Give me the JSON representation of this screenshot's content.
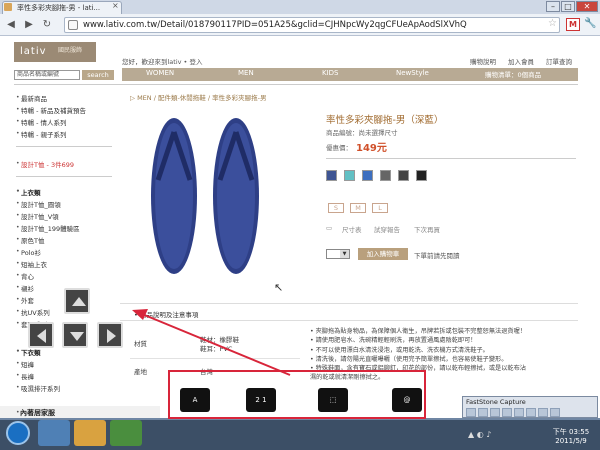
{
  "browser": {
    "tab_title": "率性多彩夾腳拖-男 - lati...",
    "tab_close": "×",
    "url": "www.lativ.com.tw/Detail/018790117PID=051A25&gclid=CJHNpcWy2qgCFUeApAodSlXVhQ",
    "win_min": "–",
    "win_max": "□",
    "win_close": "✕"
  },
  "site": {
    "logo": "lativ",
    "logo_sub": "國民服飾",
    "greeting": "您好，歡迎來到lativ • 登入",
    "top_links": [
      "購物說明",
      "加入會員",
      "訂單查詢"
    ],
    "search_placeholder": "商品名稱或編號",
    "search_button": "search",
    "categories": [
      "WOMEN",
      "MEN",
      "KIDS",
      "NewStyle"
    ],
    "cart": "購物清單：0個商品"
  },
  "sidebar": {
    "group1": [
      "最新商品",
      "特輯 - 新品及補貨預告",
      "特輯 - 情人系列",
      "特輯 - 親子系列"
    ],
    "promo": "設計T恤 - 3件699",
    "section_title": "上衣類",
    "group2": [
      "設計T恤_圓領",
      "設計T恤_V領",
      "設計T恤_199體驗區",
      "原色T恤",
      "Polo衫",
      "短袖上衣",
      "背心",
      "襯衫",
      "外套",
      "抗UV系列",
      "套頭系列"
    ],
    "section_title2": "下衣類",
    "group3": [
      "短褲",
      "長褲",
      "吸濕排汗系列"
    ],
    "bottom": "內著居家服"
  },
  "product": {
    "breadcrumb": "▷ MEN / 配件類-休閒拖鞋 / 率性多彩夾腳拖-男",
    "title": "率性多彩夾腳拖-男（深藍）",
    "code": "商品編號：尚未選擇尺寸",
    "price_label": "優惠價：",
    "price": "149元",
    "sizes": [
      "S",
      "M",
      "L"
    ],
    "actions": [
      "尺寸表",
      "試穿報告",
      "下次再買"
    ],
    "add_to_cart": "加入購物車",
    "add_note": "下單前請先閱讀",
    "notice_title": "• 商品說明及注意事項",
    "spec_rows": [
      {
        "label": "材質",
        "value": "鞋材：橡膠鞋\n鞋耳：PVC"
      },
      {
        "label": "產地",
        "value": "台灣"
      }
    ],
    "notes": [
      "• 夾腳拖為貼身物品，為保障個人衛生，吊牌若拆或包裝不完整恕無法退貨喔！",
      "• 請使用肥皂水、洗碗精輕輕刷洗，再放置通風處陰乾即可！",
      "• 不可以使用漂白水清洗浸泡，或用乾洗、洗衣機方式清洗鞋子。",
      "• 清洗後，請勿陽光直曬曝曬（使用完予簡單擦拭，也容易使鞋子變形。",
      "• 特殊鞋面，含有寶石或鋁鉚釘，印花的部份，請以乾布輕擦拭，或是以乾布沾",
      "  濕的乾或就清潔剛擦拭之。"
    ],
    "swatch_colors": [
      "#3e5593",
      "#62c0c4",
      "#3d6fbf",
      "#666666",
      "#444444",
      "#222222"
    ]
  },
  "taskbar": {
    "clock_time": "下午 03:55",
    "clock_date": "2011/5/9",
    "faststone": "FastStone Capture",
    "annot_icons": [
      "A",
      "2 1",
      "⬚",
      "@"
    ]
  }
}
